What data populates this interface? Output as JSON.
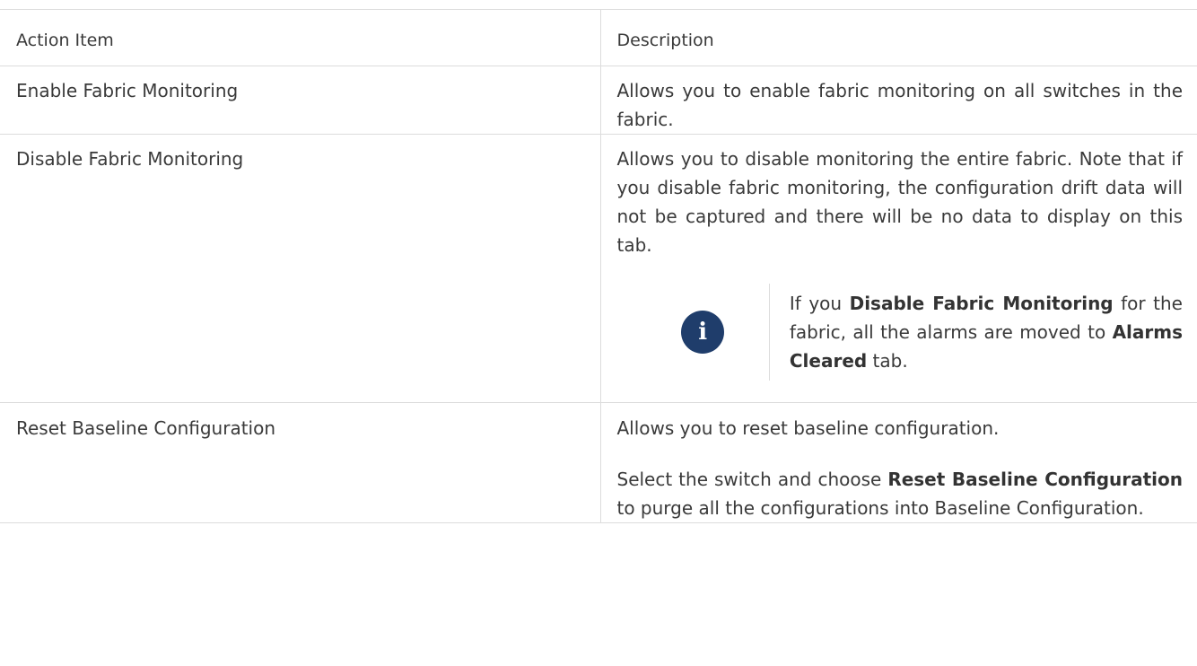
{
  "header": {
    "col1": "Action Item",
    "col2": "Description"
  },
  "rows": [
    {
      "action": "Enable Fabric Monitoring",
      "description": "Allows you to enable fabric monitoring on all switches in the fabric."
    },
    {
      "action": "Disable Fabric Monitoring",
      "description": "Allows you to disable monitoring the entire fabric. Note that if you disable fabric monitoring, the configuration drift data will not be captured and there will be no data to display on this tab.",
      "note": {
        "icon": "info-icon",
        "icon_glyph": "i",
        "t1": "If you ",
        "b1": "Disable Fabric Monitoring",
        "t2": " for the fabric, all the alarms are moved to ",
        "b2": "Alarms Cleared",
        "t3": " tab."
      }
    },
    {
      "action": "Reset Baseline Configuration",
      "description": "Allows you to reset baseline configuration.",
      "p2": {
        "t1": "Select the switch and choose ",
        "b1": "Reset Baseline Configuration",
        "t2": " to purge all the configurations into Baseline Configuration."
      }
    }
  ],
  "colors": {
    "icon_bg": "#1f3d6b",
    "border": "#dcdcdc",
    "text": "#3a3a3a"
  }
}
